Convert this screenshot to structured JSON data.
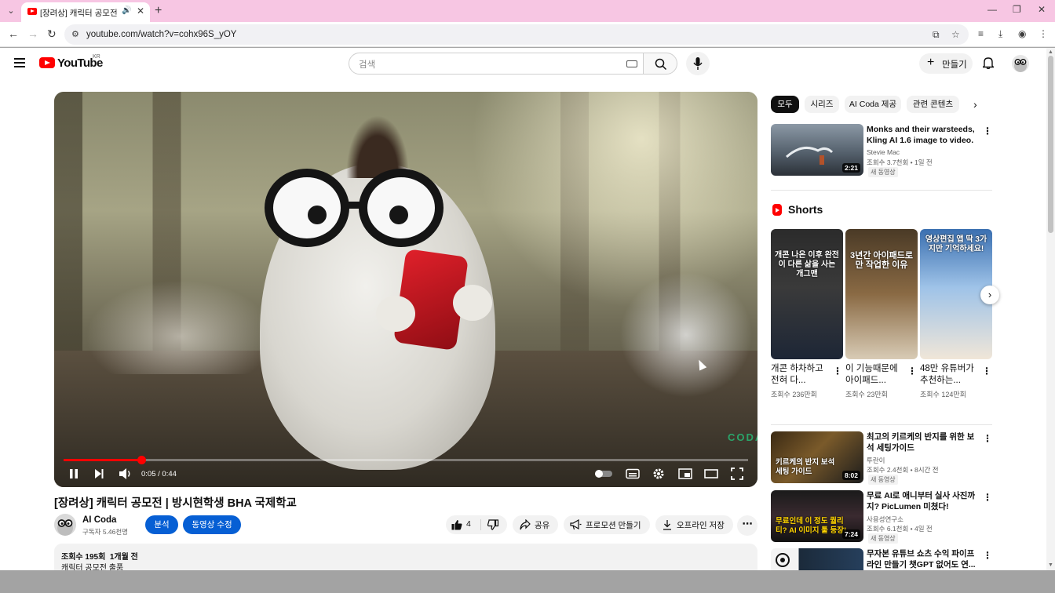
{
  "browser": {
    "tab_title": "[장려상] 캐릭터 공모전 | 방시현학생 BHA 국제학교",
    "url": "youtube.com/watch?v=cohx96S_yOY"
  },
  "header": {
    "logo_text": "YouTube",
    "country": "KR",
    "search_placeholder": "검색",
    "create_label": "만들기"
  },
  "player": {
    "current_time": "0:05",
    "duration": "0:44",
    "time_display": "0:05 / 0:44",
    "progress_fraction": 0.1136,
    "watermark": "CODA"
  },
  "video": {
    "title": "[장려상] 캐릭터 공모전 | 방시현학생 BHA 국제학교",
    "channel_name": "AI Coda",
    "subscribers": "구독자 5.46천명",
    "analytics_label": "분석",
    "edit_label": "동영상 수정",
    "like_count": "4",
    "share_label": "공유",
    "promote_label": "프로모션 만들기",
    "download_label": "오프라인 저장",
    "views_label": "조회수 195회",
    "date_label": "1개월 전",
    "description": "캐릭터 공모전 출품"
  },
  "chips": [
    "모두",
    "시리즈",
    "AI Coda 제공",
    "관련 콘텐츠"
  ],
  "recommended_top": {
    "title": "Monks and their warsteeds, Kling AI 1.6 image to video.",
    "channel": "Stevie Mac",
    "meta": "조회수 3.7천회 • 1일 전",
    "badge": "새 동영상",
    "duration": "2:21"
  },
  "shorts": {
    "heading": "Shorts",
    "items": [
      {
        "overlay": "개콘 나온 이후 완전이 다른 삶을 사는 개그맨",
        "title": "개콘 하차하고 전혀 다...",
        "views": "조회수 236만회"
      },
      {
        "overlay": "3년간 아이패드로만 작업한 이유",
        "title": "이 기능때문에 아이패드...",
        "views": "조회수 23만회"
      },
      {
        "overlay": "영상편집 앱 딱 3가지만 기억하세요!",
        "title": "48만 유튜버가 추천하는...",
        "views": "조회수 124만회"
      }
    ]
  },
  "recommended": [
    {
      "title": "최고의 키르케의 반지를 위한 보석 세팅가이드",
      "channel": "투란이",
      "meta": "조회수 2.4천회 • 8시간 전",
      "badge": "새 동영상",
      "duration": "8:02",
      "thumb_text": "키르케의 반지 보석 세팅 가이드"
    },
    {
      "title": "무료 AI로 애니부터 실사 사진까지? PicLumen 미쳤다!",
      "channel": "사용성연구소",
      "meta": "조회수 6.1천회 • 4일 전",
      "badge": "새 동영상",
      "duration": "7:24",
      "thumb_text": "무료인데 이 정도 퀄리티? AI 이미지 툴 등장!"
    },
    {
      "title": "무자본 유튜브 쇼츠 수익 파이프라인 만들기 챗GPT 없어도 연...",
      "channel": "",
      "meta": "",
      "badge": "",
      "duration": "",
      "thumb_text": ""
    }
  ],
  "colors": {
    "tab_strip": "#f7c6e3",
    "brand_red": "#ff0000",
    "accent_blue": "#065fd4"
  }
}
